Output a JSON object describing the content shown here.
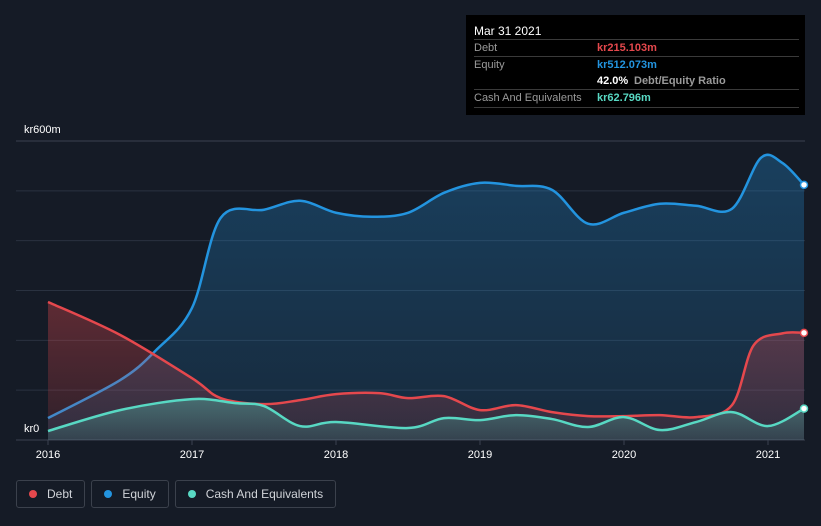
{
  "tooltip": {
    "date": "Mar 31 2021",
    "debt_label": "Debt",
    "debt_value": "kr215.103m",
    "equity_label": "Equity",
    "equity_value": "kr512.073m",
    "ratio_value": "42.0%",
    "ratio_label": "Debt/Equity Ratio",
    "cash_label": "Cash And Equivalents",
    "cash_value": "kr62.796m"
  },
  "colors": {
    "debt": "#e5484d",
    "equity": "#2394df",
    "cash": "#58d8c3"
  },
  "chart_data": {
    "type": "area",
    "y_ticks": [
      {
        "value": 0,
        "label": "kr0"
      },
      {
        "value": 600,
        "label": "kr600m"
      }
    ],
    "x_ticks": [
      {
        "value": 2016,
        "label": "2016"
      },
      {
        "value": 2017,
        "label": "2017"
      },
      {
        "value": 2018,
        "label": "2018"
      },
      {
        "value": 2019,
        "label": "2019"
      },
      {
        "value": 2020,
        "label": "2020"
      },
      {
        "value": 2021,
        "label": "2021"
      }
    ],
    "xlim": [
      2015.97,
      2021.25
    ],
    "ylim": [
      0,
      600
    ],
    "series": [
      {
        "name": "Equity",
        "key": "equity",
        "points": [
          [
            2016,
            44
          ],
          [
            2016.5,
            120
          ],
          [
            2016.75,
            180
          ],
          [
            2017,
            265
          ],
          [
            2017.2,
            446
          ],
          [
            2017.5,
            462
          ],
          [
            2017.75,
            480
          ],
          [
            2018,
            456
          ],
          [
            2018.25,
            448
          ],
          [
            2018.5,
            456
          ],
          [
            2018.75,
            496
          ],
          [
            2019,
            516
          ],
          [
            2019.25,
            510
          ],
          [
            2019.5,
            502
          ],
          [
            2019.75,
            434
          ],
          [
            2020,
            456
          ],
          [
            2020.25,
            474
          ],
          [
            2020.5,
            470
          ],
          [
            2020.75,
            464
          ],
          [
            2020.95,
            566
          ],
          [
            2021.1,
            556
          ],
          [
            2021.25,
            512
          ]
        ]
      },
      {
        "name": "Debt",
        "key": "debt",
        "points": [
          [
            2016,
            277
          ],
          [
            2016.5,
            211
          ],
          [
            2017,
            124
          ],
          [
            2017.2,
            84
          ],
          [
            2017.5,
            72
          ],
          [
            2017.75,
            80
          ],
          [
            2018,
            92
          ],
          [
            2018.3,
            94
          ],
          [
            2018.5,
            84
          ],
          [
            2018.75,
            88
          ],
          [
            2019,
            60
          ],
          [
            2019.25,
            70
          ],
          [
            2019.5,
            56
          ],
          [
            2019.75,
            48
          ],
          [
            2020,
            48
          ],
          [
            2020.25,
            50
          ],
          [
            2020.5,
            46
          ],
          [
            2020.75,
            70
          ],
          [
            2020.9,
            190
          ],
          [
            2021.1,
            214
          ],
          [
            2021.25,
            215
          ]
        ]
      },
      {
        "name": "Cash And Equivalents",
        "key": "cash",
        "points": [
          [
            2016,
            18
          ],
          [
            2016.5,
            60
          ],
          [
            2017,
            82
          ],
          [
            2017.3,
            74
          ],
          [
            2017.5,
            68
          ],
          [
            2017.75,
            28
          ],
          [
            2018,
            36
          ],
          [
            2018.5,
            24
          ],
          [
            2018.75,
            44
          ],
          [
            2019,
            40
          ],
          [
            2019.25,
            50
          ],
          [
            2019.5,
            42
          ],
          [
            2019.75,
            26
          ],
          [
            2020,
            46
          ],
          [
            2020.25,
            20
          ],
          [
            2020.5,
            36
          ],
          [
            2020.75,
            56
          ],
          [
            2021,
            28
          ],
          [
            2021.25,
            63
          ]
        ]
      }
    ]
  },
  "legend": [
    {
      "key": "debt",
      "label": "Debt"
    },
    {
      "key": "equity",
      "label": "Equity"
    },
    {
      "key": "cash",
      "label": "Cash And Equivalents"
    }
  ]
}
